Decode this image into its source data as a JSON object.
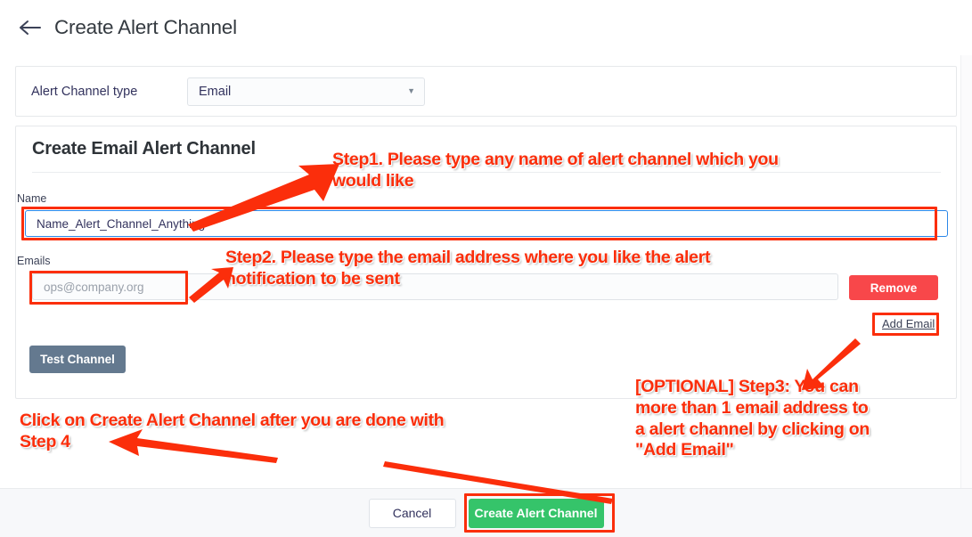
{
  "header": {
    "back_icon": "arrow-left-icon",
    "title": "Create Alert Channel"
  },
  "type_card": {
    "label": "Alert Channel type",
    "selected": "Email",
    "caret_icon": "chevron-down-icon"
  },
  "form_card": {
    "title": "Create Email Alert Channel",
    "name_label": "Name",
    "name_value": "Name_Alert_Channel_Anything",
    "emails_label": "Emails",
    "email_placeholder": "ops@company.org",
    "email_value": "",
    "remove_label": "Remove",
    "add_email_label": "Add Email",
    "test_channel_label": "Test Channel"
  },
  "footer": {
    "cancel_label": "Cancel",
    "create_label": "Create Alert Channel"
  },
  "annotations": {
    "step1": "Step1. Please type any name of alert channel which you\nwould like",
    "step2": "Step2. Please type the email address where you like the alert\nnotification to be sent",
    "step3": "[OPTIONAL] Step3: You can\nmore than 1 email address to\na alert channel by clicking on\n\"Add Email\"",
    "step4": "Click on Create Alert Channel after you are done with\nStep 4"
  },
  "colors": {
    "annotation": "#fb2e0b",
    "primary_action": "#35c46a",
    "destructive": "#f8474a",
    "secondary_action": "#64798f",
    "focus_border": "#2c88e8"
  }
}
